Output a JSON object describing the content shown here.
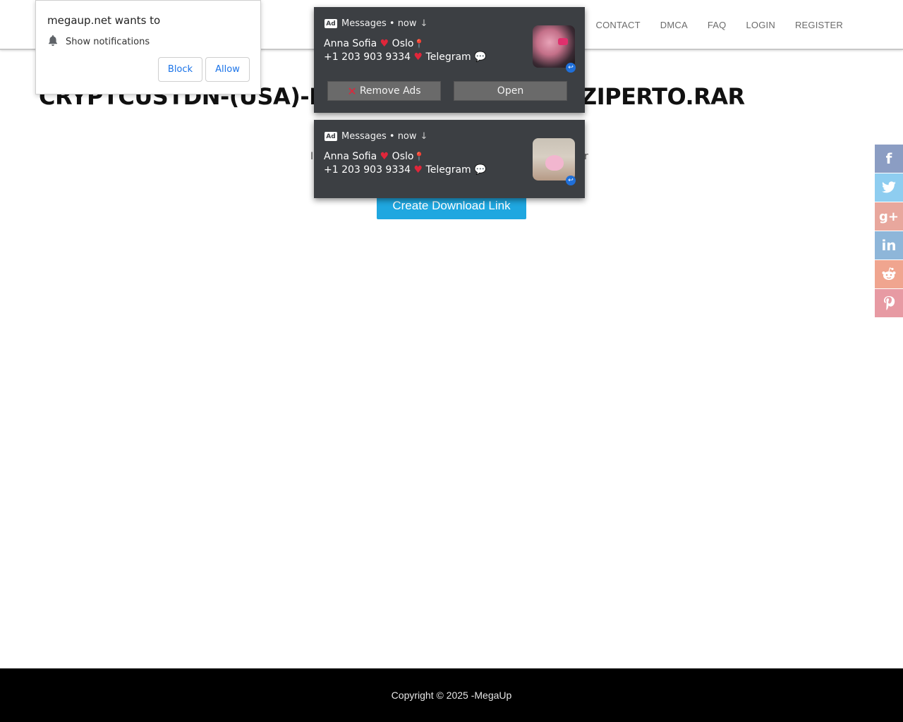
{
  "nav": {
    "items": [
      "CONTACT",
      "DMCA",
      "FAQ",
      "LOGIN",
      "REGISTER"
    ]
  },
  "main": {
    "title": "CRYPTCUSTDN-(USA)-N",
    "title_tail": "ZIPERTO.RAR",
    "subline_left": "I",
    "subline_right": "r",
    "create_button": "Create Download Link"
  },
  "footer": {
    "text_prefix": "Copyright © 2025 - ",
    "brand": "MegaUp"
  },
  "permission_prompt": {
    "title": "megaup.net wants to",
    "item": "Show notifications",
    "block_label": "Block",
    "allow_label": "Allow"
  },
  "notifications": [
    {
      "app": "Messages",
      "time": "now",
      "line1_name": "Anna Sofia",
      "line1_city": "Oslo",
      "line2_phone": "+1 203 903 9334",
      "line2_app": "Telegram",
      "remove_label": "Remove Ads",
      "open_label": "Open"
    },
    {
      "app": "Messages",
      "time": "now",
      "line1_name": "Anna Sofia",
      "line1_city": "Oslo",
      "line2_phone": "+1 203 903 9334",
      "line2_app": "Telegram"
    }
  ],
  "social": {
    "facebook_color": "#8b9dc3",
    "twitter_color": "#8ecdf0",
    "googleplus_color": "#e8a79d",
    "linkedin_color": "#8eb6d9",
    "reddit_color": "#f0a58f",
    "pinterest_color": "#e79aa3"
  }
}
